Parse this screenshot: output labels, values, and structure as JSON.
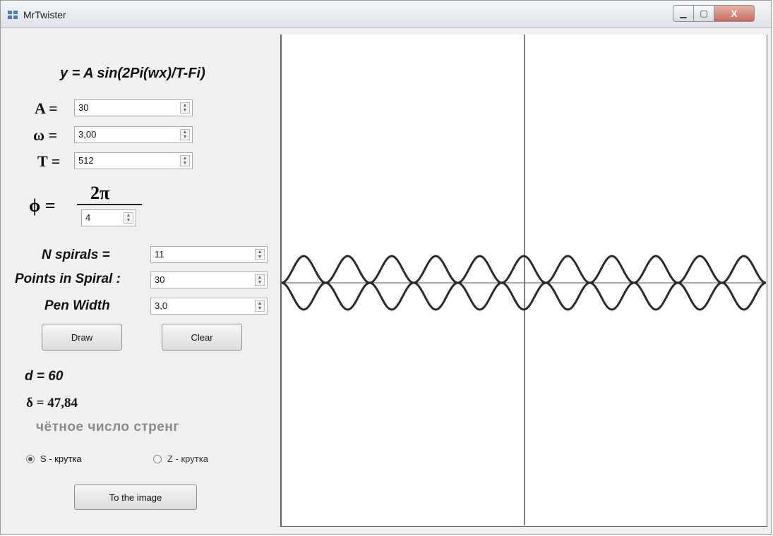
{
  "window": {
    "title": "MrTwister",
    "close_glyph": "X"
  },
  "formula": "y = A sin(2Pi(wx)/T-Fi)",
  "params": {
    "a": {
      "label": "A =",
      "value": "30"
    },
    "omega": {
      "label": "ω =",
      "value": "3,00"
    },
    "t": {
      "label": "T =",
      "value": "512"
    }
  },
  "phi": {
    "label": "ϕ =",
    "numerator": "2π",
    "denominator": "4"
  },
  "spiral": {
    "n_label": "N spirals =",
    "n_value": "11",
    "points_label": "Points in Spiral :",
    "points_value": "30",
    "pen_label": "Pen Width",
    "pen_value": "3,0"
  },
  "buttons": {
    "draw": "Draw",
    "clear": "Clear",
    "to_image": "To the image"
  },
  "results": {
    "d": "d = 60",
    "delta": "δ = 47,84",
    "parity": "чётное число стренг"
  },
  "radios": {
    "s": "S - крутка",
    "z": "Z - крутка",
    "selected": "s"
  },
  "plot": {
    "strands": 2,
    "periods_visible": 11,
    "stroke_color": "#2b2b2b"
  }
}
